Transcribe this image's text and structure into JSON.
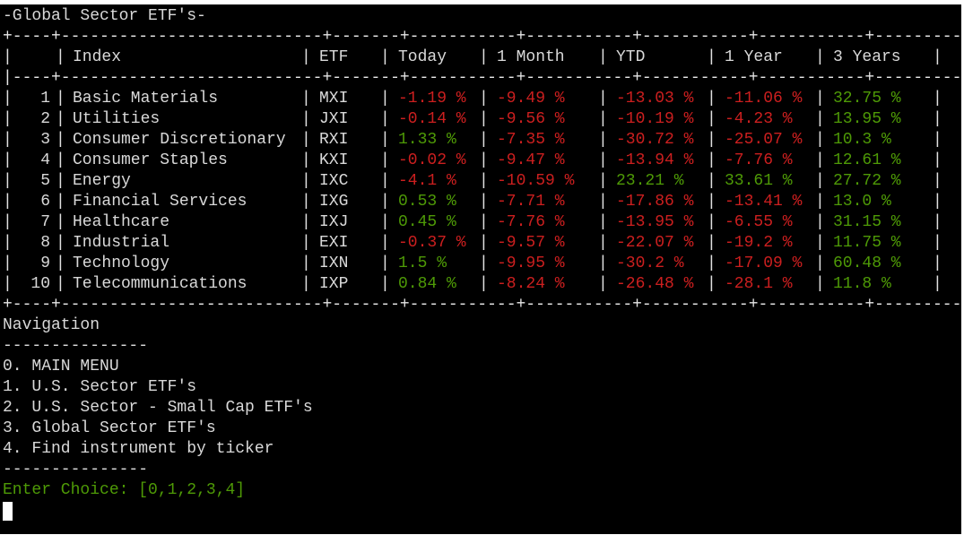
{
  "title": "-Global Sector ETF's-",
  "table": {
    "border_top": "+----+---------------------------+-------+-----------+-----------+-----------+-----------+-----------+",
    "border_mid": "|----+---------------------------+-------+-----------+-----------+-----------+-----------+-----------|",
    "border_bottom": "+----+---------------------------+-------+-----------+-----------+-----------+-----------+-----------+",
    "headers": [
      "",
      "Index",
      "ETF",
      "Today",
      "1 Month",
      "YTD",
      "1 Year",
      "3 Years"
    ],
    "rows": [
      {
        "num": "1",
        "index": "Basic Materials",
        "etf": "MXI",
        "today": "-1.19 %",
        "month": "-9.49 %",
        "ytd": "-13.03 %",
        "year": "-11.06 %",
        "three": "32.75 %"
      },
      {
        "num": "2",
        "index": "Utilities",
        "etf": "JXI",
        "today": "-0.14 %",
        "month": "-9.56 %",
        "ytd": "-10.19 %",
        "year": "-4.23 %",
        "three": "13.95 %"
      },
      {
        "num": "3",
        "index": "Consumer Discretionary",
        "etf": "RXI",
        "today": "1.33 %",
        "month": "-7.35 %",
        "ytd": "-30.72 %",
        "year": "-25.07 %",
        "three": "10.3 %"
      },
      {
        "num": "4",
        "index": "Consumer Staples",
        "etf": "KXI",
        "today": "-0.02 %",
        "month": "-9.47 %",
        "ytd": "-13.94 %",
        "year": "-7.76 %",
        "three": "12.61 %"
      },
      {
        "num": "5",
        "index": "Energy",
        "etf": "IXC",
        "today": "-4.1 %",
        "month": "-10.59 %",
        "ytd": "23.21 %",
        "year": "33.61 %",
        "three": "27.72 %"
      },
      {
        "num": "6",
        "index": "Financial Services",
        "etf": "IXG",
        "today": "0.53 %",
        "month": "-7.71 %",
        "ytd": "-17.86 %",
        "year": "-13.41 %",
        "three": "13.0 %"
      },
      {
        "num": "7",
        "index": "Healthcare",
        "etf": "IXJ",
        "today": "0.45 %",
        "month": "-7.76 %",
        "ytd": "-13.95 %",
        "year": "-6.55 %",
        "three": "31.15 %"
      },
      {
        "num": "8",
        "index": "Industrial",
        "etf": "EXI",
        "today": "-0.37 %",
        "month": "-9.57 %",
        "ytd": "-22.07 %",
        "year": "-19.2 %",
        "three": "11.75 %"
      },
      {
        "num": "9",
        "index": "Technology",
        "etf": "IXN",
        "today": "1.5 %",
        "month": "-9.95 %",
        "ytd": "-30.2 %",
        "year": "-17.09 %",
        "three": "60.48 %"
      },
      {
        "num": "10",
        "index": "Telecommunications",
        "etf": "IXP",
        "today": "0.84 %",
        "month": "-8.24 %",
        "ytd": "-26.48 %",
        "year": "-28.1 %",
        "three": "11.8 %"
      }
    ]
  },
  "navigation": {
    "heading": "Navigation",
    "rule": "---------------",
    "items": [
      "0. MAIN MENU",
      "1. U.S. Sector ETF's",
      "2. U.S. Sector - Small Cap ETF's",
      "3. Global Sector ETF's",
      "4. Find instrument by ticker"
    ],
    "rule_bottom": "---------------",
    "prompt": "Enter Choice: [0,1,2,3,4]"
  },
  "colors": {
    "background": "#000000",
    "text": "#d9d9d9",
    "negative": "#cc1f1f",
    "positive": "#4e9a06",
    "table_rule": "#c4a000",
    "prompt": "#4e9a06"
  }
}
